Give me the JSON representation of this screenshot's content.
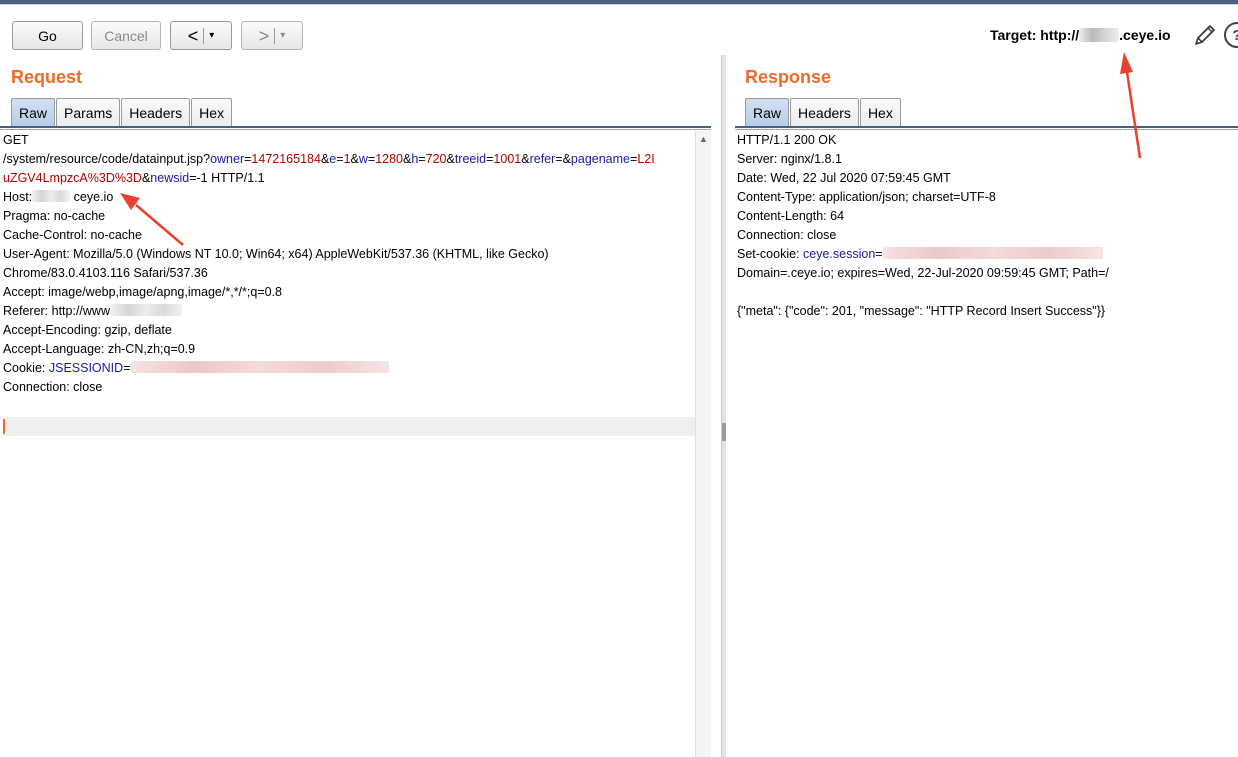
{
  "toolbar": {
    "go": "Go",
    "cancel": "Cancel",
    "back": "<",
    "forward": ">",
    "dropdown": "▾"
  },
  "target": {
    "prefix": "Target: http://",
    "suffix": ".ceye.io"
  },
  "request": {
    "title": "Request",
    "tabs": [
      "Raw",
      "Params",
      "Headers",
      "Hex"
    ],
    "active_tab": "Raw",
    "lines": {
      "l1": "GET",
      "l2_path": "/system/resource/code/datainput.jsp?",
      "l2_owner_k": "owner",
      "l2_owner_v": "1472165184",
      "l2_e_k": "e",
      "l2_e_v": "1",
      "l2_w_k": "w",
      "l2_w_v": "1280",
      "l2_h_k": "h",
      "l2_h_v": "720",
      "l2_treeid_k": "treeid",
      "l2_treeid_v": "1001",
      "l2_refer_k": "refer",
      "l2_pagename_k": "pagename",
      "l2_pagename_v": "L2I",
      "l3_v": "uZGV4LmpzcA%3D%3D",
      "l3_newsid_k": "newsid",
      "l3_tail": "=-1 HTTP/1.1",
      "host_label": "Host:",
      "host_suffix": "ceye.io",
      "pragma": "Pragma: no-cache",
      "cache": "Cache-Control: no-cache",
      "ua1": "User-Agent: Mozilla/5.0 (Windows NT 10.0; Win64; x64) AppleWebKit/537.36 (KHTML, like Gecko)",
      "ua2": "Chrome/83.0.4103.116 Safari/537.36",
      "accept": "Accept: image/webp,image/apng,image/*,*/*;q=0.8",
      "referer": "Referer: http://www",
      "encoding": "Accept-Encoding: gzip, deflate",
      "language": "Accept-Language: zh-CN,zh;q=0.9",
      "cookie_label": "Cookie: ",
      "cookie_key": "JSESSIONID",
      "connection": "Connection: close"
    }
  },
  "response": {
    "title": "Response",
    "tabs": [
      "Raw",
      "Headers",
      "Hex"
    ],
    "active_tab": "Raw",
    "lines": {
      "status": "HTTP/1.1 200 OK",
      "server": "Server: nginx/1.8.1",
      "date": "Date: Wed, 22 Jul 2020 07:59:45 GMT",
      "ctype": "Content-Type: application/json; charset=UTF-8",
      "clen": "Content-Length: 64",
      "conn": "Connection: close",
      "setcookie_label": "Set-cookie: ",
      "setcookie_key": "ceye.session",
      "domain": "Domain=.ceye.io; expires=Wed, 22-Jul-2020 09:59:45 GMT; Path=/",
      "body": "{\"meta\": {\"code\": 201, \"message\": \"HTTP Record Insert Success\"}}"
    }
  },
  "colors": {
    "accent": "#f06a28",
    "param_key": "#1a1aa6",
    "param_value": "#b30000",
    "annotation_arrow": "#e8412c"
  }
}
